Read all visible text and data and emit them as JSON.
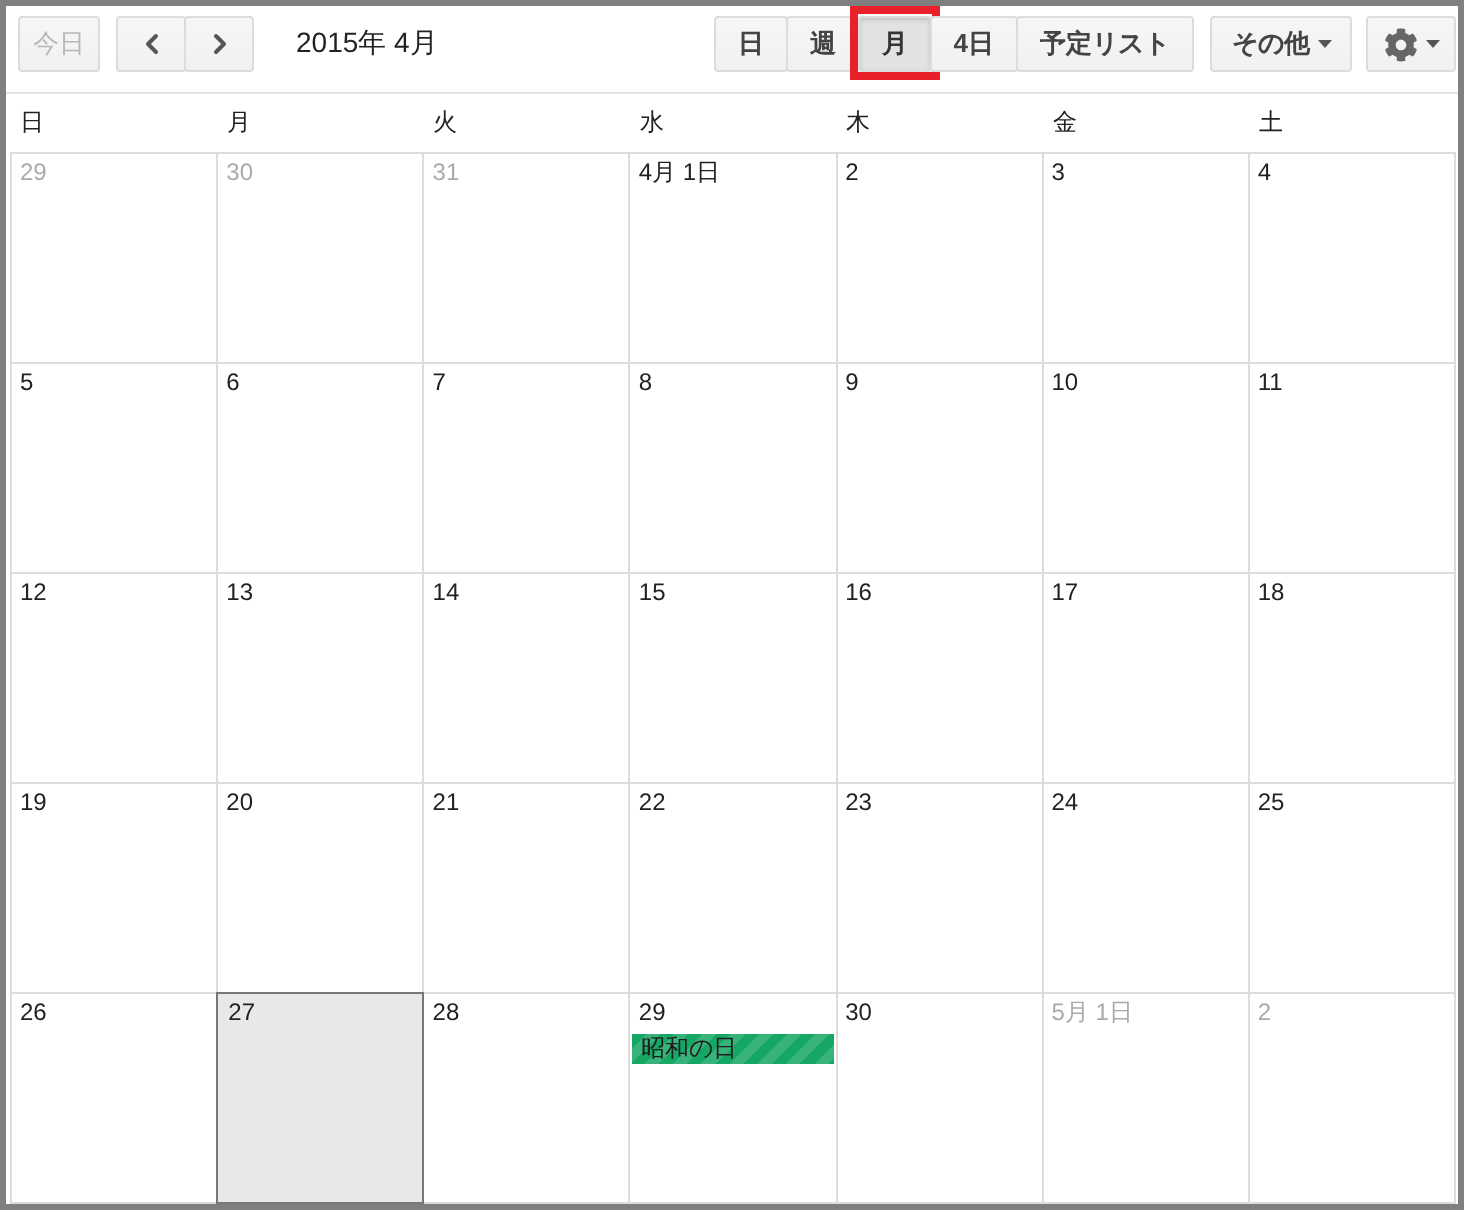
{
  "toolbar": {
    "today_button": {
      "label": "今日",
      "disabled": true
    },
    "title": "2015年 4月",
    "views": [
      {
        "label": "日",
        "selected": false,
        "highlighted": false
      },
      {
        "label": "週",
        "selected": false,
        "highlighted": false
      },
      {
        "label": "月",
        "selected": true,
        "highlighted": true
      },
      {
        "label": "4日",
        "selected": false,
        "highlighted": false
      },
      {
        "label": "予定リスト",
        "selected": false,
        "highlighted": false
      }
    ],
    "more_button": {
      "label": "その他"
    }
  },
  "weekdays": [
    "日",
    "月",
    "火",
    "水",
    "木",
    "金",
    "土"
  ],
  "weeks": [
    {
      "days": [
        {
          "label": "29",
          "other_month": true,
          "today": false
        },
        {
          "label": "30",
          "other_month": true,
          "today": false
        },
        {
          "label": "31",
          "other_month": true,
          "today": false
        },
        {
          "label": "4月 1日",
          "other_month": false,
          "today": false
        },
        {
          "label": "2",
          "other_month": false,
          "today": false
        },
        {
          "label": "3",
          "other_month": false,
          "today": false
        },
        {
          "label": "4",
          "other_month": false,
          "today": false
        }
      ]
    },
    {
      "days": [
        {
          "label": "5",
          "other_month": false,
          "today": false
        },
        {
          "label": "6",
          "other_month": false,
          "today": false
        },
        {
          "label": "7",
          "other_month": false,
          "today": false
        },
        {
          "label": "8",
          "other_month": false,
          "today": false
        },
        {
          "label": "9",
          "other_month": false,
          "today": false
        },
        {
          "label": "10",
          "other_month": false,
          "today": false
        },
        {
          "label": "11",
          "other_month": false,
          "today": false
        }
      ]
    },
    {
      "days": [
        {
          "label": "12",
          "other_month": false,
          "today": false
        },
        {
          "label": "13",
          "other_month": false,
          "today": false
        },
        {
          "label": "14",
          "other_month": false,
          "today": false
        },
        {
          "label": "15",
          "other_month": false,
          "today": false
        },
        {
          "label": "16",
          "other_month": false,
          "today": false
        },
        {
          "label": "17",
          "other_month": false,
          "today": false
        },
        {
          "label": "18",
          "other_month": false,
          "today": false
        }
      ]
    },
    {
      "days": [
        {
          "label": "19",
          "other_month": false,
          "today": false
        },
        {
          "label": "20",
          "other_month": false,
          "today": false
        },
        {
          "label": "21",
          "other_month": false,
          "today": false
        },
        {
          "label": "22",
          "other_month": false,
          "today": false
        },
        {
          "label": "23",
          "other_month": false,
          "today": false
        },
        {
          "label": "24",
          "other_month": false,
          "today": false
        },
        {
          "label": "25",
          "other_month": false,
          "today": false
        }
      ]
    },
    {
      "days": [
        {
          "label": "26",
          "other_month": false,
          "today": false
        },
        {
          "label": "27",
          "other_month": false,
          "today": true
        },
        {
          "label": "28",
          "other_month": false,
          "today": false
        },
        {
          "label": "29",
          "other_month": false,
          "today": false,
          "events": [
            {
              "title": "昭和の日",
              "color": "#16a765"
            }
          ]
        },
        {
          "label": "30",
          "other_month": false,
          "today": false
        },
        {
          "label": "5月 1日",
          "other_month": true,
          "today": false
        },
        {
          "label": "2",
          "other_month": true,
          "today": false
        }
      ]
    }
  ]
}
